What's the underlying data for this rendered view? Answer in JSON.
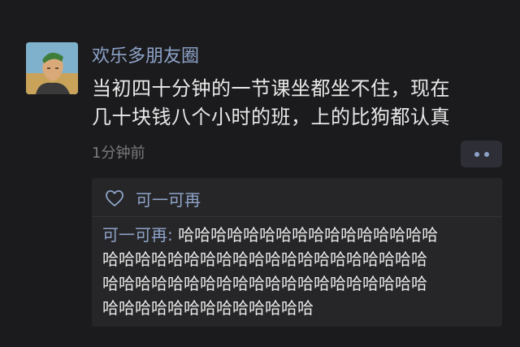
{
  "post": {
    "author": "欢乐多朋友圈",
    "content_lines": [
      "当初四十分钟的一节课坐都坐不住，现在",
      "几十块钱八个小时的班，上的比狗都认真"
    ],
    "time": "1分钟前"
  },
  "likes": {
    "names": "可一可再"
  },
  "comment": {
    "author": "可一可再",
    "separator": ": ",
    "lines": [
      "哈哈哈哈哈哈哈哈哈哈哈哈哈哈哈哈",
      "哈哈哈哈哈哈哈哈哈哈哈哈哈哈哈哈哈哈哈哈",
      "哈哈哈哈哈哈哈哈哈哈哈哈哈哈哈哈哈哈哈哈",
      "哈哈哈哈哈哈哈哈哈哈哈哈哈"
    ]
  },
  "colors": {
    "background": "#1b1b1d",
    "name_accent": "#8ea3c9",
    "text": "#e8e8e8",
    "muted": "#7a7a7a",
    "panel": "#262628"
  },
  "icons": {
    "like": "heart-outline-icon",
    "more": "two-dot-more-icon"
  }
}
